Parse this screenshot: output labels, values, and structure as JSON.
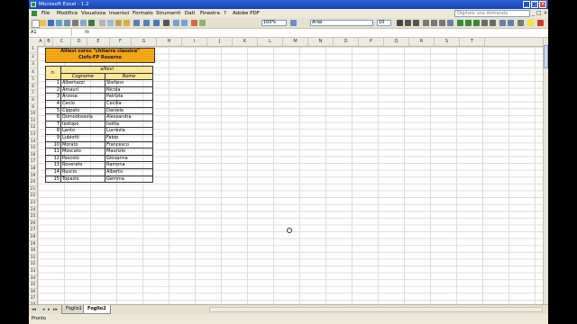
{
  "window": {
    "title": "Microsoft Excel - 1.2",
    "min": "_",
    "max": "□",
    "close": "×"
  },
  "menu": {
    "items": [
      "File",
      "Modifica",
      "Visualizza",
      "Inserisci",
      "Formato",
      "Strumenti",
      "Dati",
      "Finestra",
      "?",
      "Adobe PDF"
    ],
    "help_placeholder": "Digitare una domanda"
  },
  "toolbar": {
    "zoom": "100%",
    "font": "Arial",
    "size": "10"
  },
  "formula": {
    "namebox": "A1",
    "fx": "fx"
  },
  "columns": [
    "A",
    "B",
    "C",
    "D",
    "E",
    "F",
    "G",
    "H",
    "I",
    "J",
    "K",
    "L",
    "M",
    "N",
    "O",
    "P",
    "Q",
    "R",
    "S",
    "T"
  ],
  "rows": [
    "1",
    "2",
    "3",
    "4",
    "5",
    "6",
    "7",
    "8",
    "9",
    "10",
    "11",
    "12",
    "13",
    "14",
    "15",
    "16",
    "17",
    "18",
    "19",
    "20",
    "21",
    "22",
    "23",
    "24",
    "25",
    "26",
    "27",
    "28",
    "29",
    "30",
    "31",
    "32",
    "33",
    "34",
    "35",
    "36",
    "37",
    "38"
  ],
  "sheet": {
    "title_line1": "Allievi corso \"chitarra classica\"",
    "title_line2": "Ciofs-FP Rosarno",
    "group_header": "allievi",
    "col_n": "n.",
    "col_cognome": "Cognome",
    "col_nome": "Nome",
    "students": [
      {
        "n": "1",
        "cognome": "Albertazzi",
        "nome": "Stefano"
      },
      {
        "n": "2",
        "cognome": "Amauri",
        "nome": "Nicola"
      },
      {
        "n": "3",
        "cognome": "Arzosa",
        "nome": "Patrizia"
      },
      {
        "n": "4",
        "cognome": "Cecio",
        "nome": "Cecilia"
      },
      {
        "n": "5",
        "cognome": "Cippato",
        "nome": "Daniele"
      },
      {
        "n": "6",
        "cognome": "Domodossola",
        "nome": "Alessandra"
      },
      {
        "n": "7",
        "cognome": "Isotopo",
        "nome": "Isotta"
      },
      {
        "n": "8",
        "cognome": "Lanto",
        "nome": "Lucrezia"
      },
      {
        "n": "9",
        "cognome": "Lubiotti",
        "nome": "Fabio"
      },
      {
        "n": "10",
        "cognome": "Morato",
        "nome": "Francesco"
      },
      {
        "n": "11",
        "cognome": "Moscato",
        "nome": "Maurizio"
      },
      {
        "n": "12",
        "cognome": "Pascolo",
        "nome": "Giovanna"
      },
      {
        "n": "13",
        "cognome": "Roverato",
        "nome": "Ramona"
      },
      {
        "n": "14",
        "cognome": "Ruscio",
        "nome": "Alberto"
      },
      {
        "n": "15",
        "cognome": "Topazio",
        "nome": "Gemma"
      }
    ]
  },
  "tabs": [
    "Foglio1",
    "Foglio2"
  ],
  "status": "Pronto",
  "colors": {
    "title_fill": "#f2a614",
    "header_fill": "#fce79a",
    "titlebar": "#2b5fd6"
  }
}
